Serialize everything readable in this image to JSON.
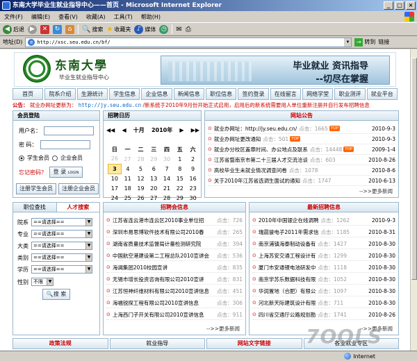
{
  "window": {
    "title": "东南大学毕业生就业指导中心——首页 - Microsoft Internet Explorer",
    "min": "_",
    "max": "□",
    "close": "×"
  },
  "menu": [
    "文件(F)",
    "编辑(E)",
    "查看(V)",
    "收藏(A)",
    "工具(T)",
    "帮助(H)"
  ],
  "toolbar": {
    "back": "后退",
    "search": "搜索",
    "favorites": "收藏夹",
    "media": "媒体"
  },
  "address": {
    "label": "地址(D)",
    "url": "http://xsc.seu.edu.cn/bf/",
    "go": "转到",
    "links": "链接"
  },
  "status": {
    "left": "",
    "zone": "Internet"
  },
  "header": {
    "logo_text": "东南大學",
    "logo_sub": "毕业生就业指导中心",
    "banner_line1": "毕业就业  资讯指导",
    "banner_line2": "--切尽在掌握"
  },
  "nav": [
    "首页",
    "院系介绍",
    "生源统计",
    "学生信息",
    "企业信息",
    "新闻信息",
    "职位信息",
    "签约登录",
    "在线留言",
    "网络学堂",
    "职业测评",
    "就业平台"
  ],
  "notice": {
    "label": "公告：",
    "text1": "就业办网址更新为：",
    "url": "http://jy.seu.edu.cn",
    "text2": "/新系统于2010年9月份开始正式启用，启用后的新系统需要用人单位重新注册并自行发布招聘信息"
  },
  "login": {
    "title": "会员登陆",
    "user_label": "用户名：",
    "pass_label": "密  码：",
    "opt_student": "学生会员",
    "opt_company": "企业会员",
    "forgot": "忘记密码？",
    "login_btn": "登 录",
    "login_small": "LOGIN",
    "reg_student": "注册学生会员",
    "reg_company": "注册企业会员"
  },
  "calendar": {
    "title": "招聘日历",
    "month": "十月",
    "year": "2010年",
    "weekdays": [
      "日",
      "一",
      "二",
      "三",
      "四",
      "五",
      "六"
    ],
    "rows": [
      [
        [
          "26",
          1
        ],
        [
          "27",
          1
        ],
        [
          "28",
          1
        ],
        [
          "29",
          1
        ],
        [
          "30",
          1
        ],
        [
          "1",
          0
        ],
        [
          "2",
          0
        ]
      ],
      [
        [
          "3",
          2
        ],
        [
          "4",
          0
        ],
        [
          "5",
          0
        ],
        [
          "6",
          0
        ],
        [
          "7",
          0
        ],
        [
          "8",
          0
        ],
        [
          "9",
          0
        ]
      ],
      [
        [
          "10",
          0
        ],
        [
          "11",
          0
        ],
        [
          "12",
          0
        ],
        [
          "13",
          0
        ],
        [
          "14",
          0
        ],
        [
          "15",
          0
        ],
        [
          "16",
          0
        ]
      ],
      [
        [
          "17",
          0
        ],
        [
          "18",
          0
        ],
        [
          "19",
          0
        ],
        [
          "20",
          0
        ],
        [
          "21",
          0
        ],
        [
          "22",
          0
        ],
        [
          "23",
          0
        ]
      ],
      [
        [
          "24",
          0
        ],
        [
          "25",
          0
        ],
        [
          "26",
          0
        ],
        [
          "27",
          0
        ],
        [
          "28",
          0
        ],
        [
          "29",
          0
        ],
        [
          "30",
          0
        ]
      ]
    ]
  },
  "announce": {
    "title": "网站公告",
    "more": "-->>更多新闻",
    "items": [
      {
        "t": "就业办网址：http://jy.seu.edu.cn/",
        "h": "点击：1665",
        "top": true,
        "d": "2010-9-3"
      },
      {
        "t": "就业办网址更改通知",
        "h": "点击：501",
        "top": true,
        "d": "2010-9-3"
      },
      {
        "t": "就业办分校区盖章时间、办公地点及联系",
        "h": "点击：14448",
        "top": true,
        "d": "2009-1-4"
      },
      {
        "t": "江苏省暨南京市第二十三届人才交流洽谈",
        "h": "点击：603",
        "top": false,
        "d": "2010-8-26"
      },
      {
        "t": "高校毕业生未就业情况调查问卷",
        "h": "点击：1078",
        "top": false,
        "d": "2010-8-6"
      },
      {
        "t": "关于2010年江苏省选调生面试的通知",
        "h": "点击：1747",
        "top": false,
        "d": "2010-6-13"
      }
    ]
  },
  "search": {
    "tab1": "职位查找",
    "tab2": "人才搜索",
    "placeholder": "==请选择==",
    "rows": [
      "院系",
      "专业",
      "大类",
      "类别",
      "学历"
    ],
    "gender_label": "性别",
    "gender_val": "不限",
    "btn": "搜 索"
  },
  "recruit": {
    "title": "招聘会信息",
    "more": "-->>更多新闻",
    "items": [
      {
        "t": "江苏省连云港市连云区2010事业单位招",
        "h": "点击：726"
      },
      {
        "t": "深圳市易思博软件技术有限公司2010春",
        "h": "点击：265"
      },
      {
        "t": "湖南省质量技术监督局计量检测研究院",
        "h": "点击：394"
      },
      {
        "t": "中国航空港建设第二工程总队2010宣讲会",
        "h": "点击：536"
      },
      {
        "t": "海澜集团2010校园宣讲",
        "h": "点击：835"
      },
      {
        "t": "无锡市增长投资咨询有限公司2010宣讲",
        "h": "点击：831"
      },
      {
        "t": "江苏恒神纤维材料有限公司2010宣讲信息",
        "h": "点击：451"
      },
      {
        "t": "海福锐探工程有限公司2010宣讲信息",
        "h": "点击：306"
      },
      {
        "t": "上海西门子开关有限公司2010宣讲信息",
        "h": "点击：911"
      }
    ]
  },
  "jobs": {
    "title": "最新招聘信息",
    "more": "-->>更多新闻",
    "items": [
      {
        "t": "2010年中国银企在线调聘",
        "h": "点击：1262",
        "d": "2010-9-3"
      },
      {
        "t": "瑞晨骏电子2011年需求信",
        "h": "点击：1185",
        "d": "2010-8-31"
      },
      {
        "t": "南京浦镇海泰制动设备有",
        "h": "点击：1427",
        "d": "2010-8-30"
      },
      {
        "t": "上海苏安交通工程设计有",
        "h": "点击：1299",
        "d": "2010-8-30"
      },
      {
        "t": "厦门市安通锂电池研发中",
        "h": "点击：1118",
        "d": "2010-8-30"
      },
      {
        "t": "南京学苏乐数据科技有限",
        "h": "点击：1052",
        "d": "2010-8-30"
      },
      {
        "t": "华润置地（合肥）有限公",
        "h": "点击：1097",
        "d": "2010-8-30"
      },
      {
        "t": "河北新天际建筑设计有限",
        "h": "点击：711",
        "d": "2010-8-30"
      },
      {
        "t": "四川省交通厅公路规划勘",
        "h": "点击：1741",
        "d": "2010-8-26"
      }
    ]
  },
  "bottom": [
    "政策法规",
    "就业指导",
    "网站文字链接",
    "各业就业专区"
  ],
  "watermark": "7OOLS"
}
